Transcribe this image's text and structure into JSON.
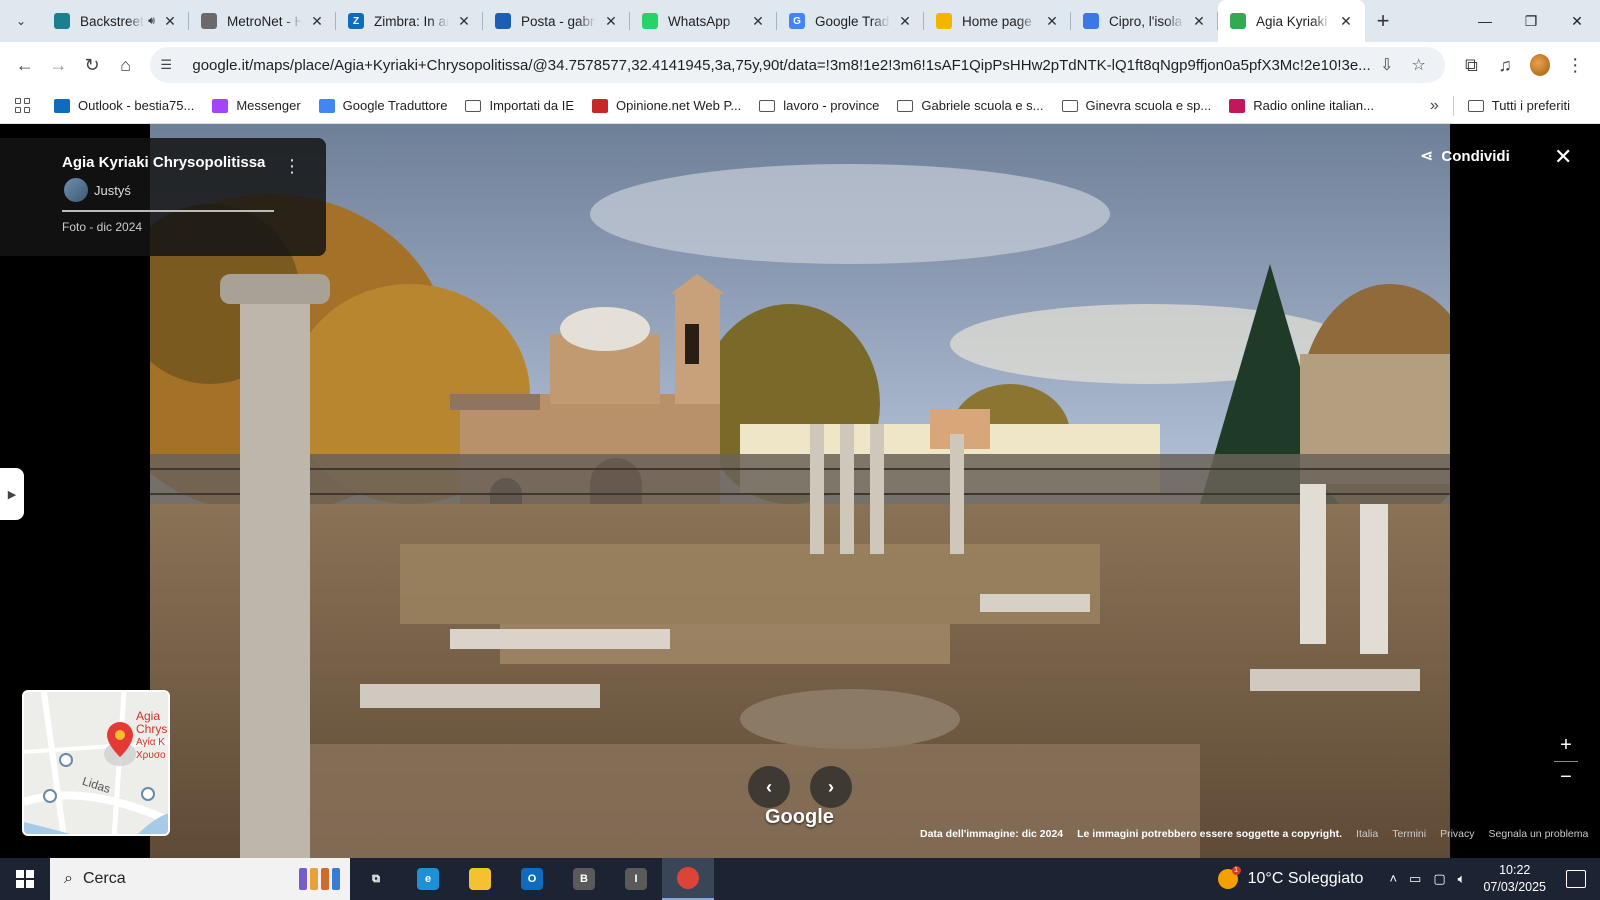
{
  "browser": {
    "tabs": [
      {
        "title": "Backstreet",
        "favicon_color": "#1a7f8e",
        "favicon_glyph": "",
        "has_audio": true
      },
      {
        "title": "MetroNet - H",
        "favicon_color": "#6a6a6a",
        "favicon_glyph": ""
      },
      {
        "title": "Zimbra: In ar",
        "favicon_color": "#0f6cbd",
        "favicon_glyph": "Z"
      },
      {
        "title": "Posta - gabri",
        "favicon_color": "#1a5fb4",
        "favicon_glyph": ""
      },
      {
        "title": "WhatsApp",
        "favicon_color": "#25d366",
        "favicon_glyph": ""
      },
      {
        "title": "Google Tradu",
        "favicon_color": "#4285f4",
        "favicon_glyph": "G"
      },
      {
        "title": "Home page -",
        "favicon_color": "#f4b400",
        "favicon_glyph": ""
      },
      {
        "title": "Cipro, l'isola",
        "favicon_color": "#3b78e7",
        "favicon_glyph": ""
      },
      {
        "title": "Agia Kyriaki C",
        "favicon_color": "#34a853",
        "favicon_glyph": "",
        "active": true
      }
    ],
    "url": "google.it/maps/place/Agia+Kyriaki+Chrysopolitissa/@34.7578577,32.4141945,3a,75y,90t/data=!3m8!1e2!3m6!1sAF1QipPsHHw2pTdNTK-lQ1ft8qNgp9ffjon0a5pfX3Mc!2e10!3e...",
    "bookmarks": [
      {
        "label": "Outlook - bestia75...",
        "kind": "app",
        "color": "#0f6cbd"
      },
      {
        "label": "Messenger",
        "kind": "app",
        "color": "#a445f7"
      },
      {
        "label": "Google Traduttore",
        "kind": "app",
        "color": "#4285f4"
      },
      {
        "label": "Importati da IE",
        "kind": "folder"
      },
      {
        "label": "Opinione.net Web P...",
        "kind": "app",
        "color": "#c62828"
      },
      {
        "label": "lavoro - province",
        "kind": "folder"
      },
      {
        "label": "Gabriele scuola e s...",
        "kind": "folder"
      },
      {
        "label": "Ginevra scuola e sp...",
        "kind": "folder"
      },
      {
        "label": "Radio online italian...",
        "kind": "app",
        "color": "#c2185b"
      }
    ],
    "all_bookmarks_label": "Tutti i preferiti"
  },
  "maps": {
    "place_name": "Agia Kyriaki Chrysopolitissa",
    "author": "Justyś",
    "photo_date": "Foto - dic 2024",
    "share_label": "Condividi",
    "google_logo": "Google",
    "minimap": {
      "pin_label_1": "Agia",
      "pin_label_2": "Chrys",
      "pin_label_3": "Αγία Κ",
      "pin_label_4": "Χρυσο",
      "street": "Lidas"
    },
    "footer": {
      "image_date": "Data dell'immagine: dic 2024",
      "copyright": "Le immagini potrebbero essere soggette a copyright.",
      "country": "Italia",
      "terms": "Termini",
      "privacy": "Privacy",
      "report": "Segnala un problema"
    }
  },
  "taskbar": {
    "search_placeholder": "Cerca",
    "weather": "10°C  Soleggiato",
    "weather_badge": "1",
    "time": "10:22",
    "date": "07/03/2025",
    "apps": [
      {
        "name": "task-view",
        "glyph": "⧉",
        "color": "#ffffff"
      },
      {
        "name": "edge",
        "glyph": "e",
        "color": "#1e90d6"
      },
      {
        "name": "file-explorer",
        "glyph": "",
        "color": "#f2c230"
      },
      {
        "name": "outlook",
        "glyph": "O",
        "color": "#0f6cbd"
      },
      {
        "name": "app-b",
        "glyph": "B",
        "color": "#5a5a5a"
      },
      {
        "name": "app-i",
        "glyph": "I",
        "color": "#5a5a5a"
      },
      {
        "name": "chrome",
        "glyph": "",
        "color": "#db4437",
        "active": true
      }
    ]
  }
}
